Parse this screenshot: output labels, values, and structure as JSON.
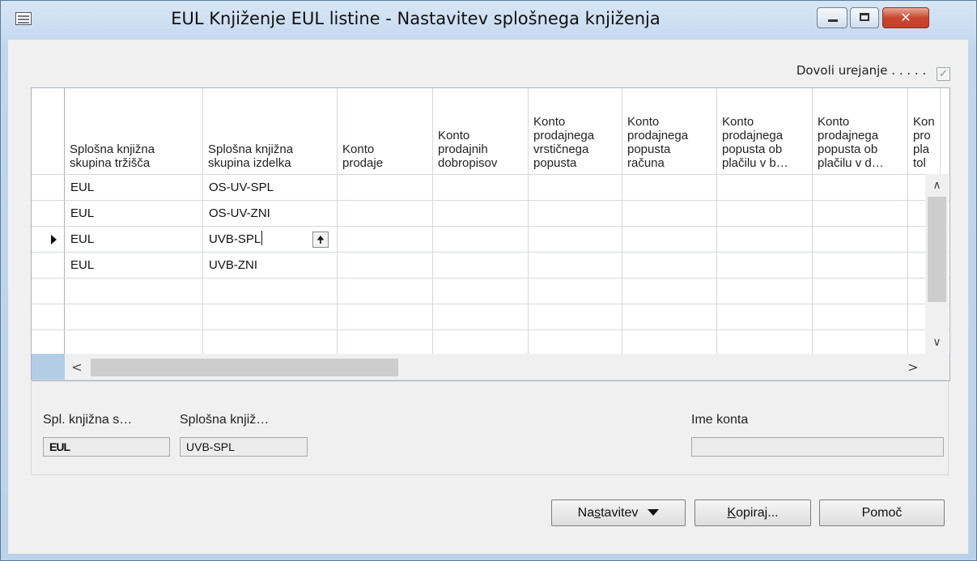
{
  "window": {
    "title": "EUL Knjiženje EUL listine - Nastavitev splošnega knjiženja",
    "close_glyph": "✕"
  },
  "allow_edit": {
    "label": "Dovoli urejanje . . . . .",
    "checked": true,
    "check_glyph": "✓"
  },
  "grid": {
    "columns": [
      "Splošna knjižna\nskupina tržišča",
      "Splošna knjižna\nskupina izdelka",
      "Konto\nprodaje",
      "Konto\nprodajnih\ndobropisov",
      "Konto\nprodajnega\nvrstičnega\npopusta",
      "Konto\nprodajnega\npopusta\nračuna",
      "Konto\nprodajnega\npopusta ob\nplačilu v b…",
      "Konto\nprodajnega\npopusta ob\nplačilu v d…",
      "Kon\npro\npla\ntol"
    ],
    "rows": [
      [
        "EUL",
        "OS-UV-SPL"
      ],
      [
        "EUL",
        "OS-UV-ZNI"
      ],
      [
        "EUL",
        "UVB-SPL"
      ],
      [
        "EUL",
        "UVB-ZNI"
      ]
    ],
    "current_row": 3,
    "lookup_glyph": "🠉",
    "scroll_glyphs": {
      "up": "∧",
      "down": "∨",
      "left": "<",
      "right": ">"
    }
  },
  "details": {
    "field1_label": "Spl. knjižna s…",
    "field1_value": "EUL",
    "field2_label": "Splošna knjiž…",
    "field2_value": "UVB-SPL",
    "field3_label": "Ime konta",
    "field3_value": ""
  },
  "buttons": {
    "setup_pre": "Na",
    "setup_key": "s",
    "setup_post": "tavitev",
    "copy_key": "K",
    "copy_post": "opiraj...",
    "help": "Pomoč"
  }
}
